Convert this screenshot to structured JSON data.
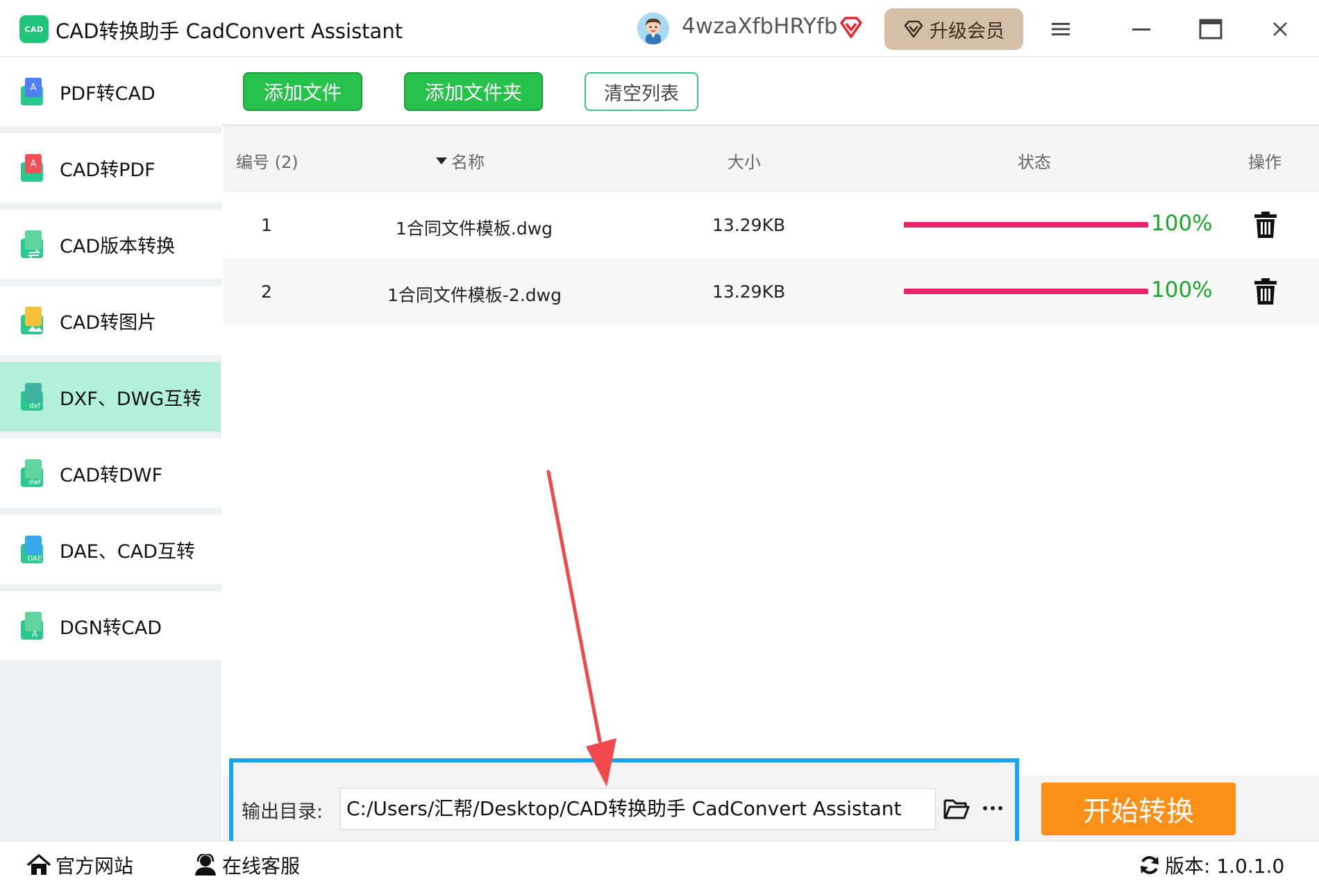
{
  "window": {
    "logo_text": "CAD",
    "title": "CAD转换助手 CadConvert Assistant",
    "username": "4wzaXfbHRYfb",
    "upgrade_label": "升级会员",
    "icons": [
      "avatar",
      "vip-icon",
      "menu-icon",
      "minimize-icon",
      "maximize-icon",
      "close-icon"
    ]
  },
  "sidebar": {
    "items": [
      {
        "label": "PDF转CAD",
        "icon": "pdf-to-cad-icon",
        "active": false
      },
      {
        "label": "CAD转PDF",
        "icon": "cad-to-pdf-icon",
        "active": false
      },
      {
        "label": "CAD版本转换",
        "icon": "cad-version-icon",
        "active": false
      },
      {
        "label": "CAD转图片",
        "icon": "cad-to-image-icon",
        "active": false
      },
      {
        "label": "DXF、DWG互转",
        "icon": "dxf-dwg-icon",
        "active": true
      },
      {
        "label": "CAD转DWF",
        "icon": "cad-to-dwf-icon",
        "active": false
      },
      {
        "label": "DAE、CAD互转",
        "icon": "dae-cad-icon",
        "active": false
      },
      {
        "label": "DGN转CAD",
        "icon": "dgn-to-cad-icon",
        "active": false
      }
    ]
  },
  "toolbar": {
    "add_file": "添加文件",
    "add_folder": "添加文件夹",
    "clear_list": "清空列表"
  },
  "table": {
    "headers": {
      "index": "编号 (2)",
      "name": "名称",
      "size": "大小",
      "status": "状态",
      "action": "操作"
    },
    "rows": [
      {
        "index": "1",
        "name": "1合同文件模板.dwg",
        "size": "13.29KB",
        "progress": 1.0,
        "percent": "100%"
      },
      {
        "index": "2",
        "name": "1合同文件模板-2.dwg",
        "size": "13.29KB",
        "progress": 1.0,
        "percent": "100%"
      }
    ]
  },
  "output": {
    "label": "输出目录:",
    "path": "C:/Users/汇帮/Desktop/CAD转换助手 CadConvert Assistant"
  },
  "start_button": "开始转换",
  "footer": {
    "website": "官方网站",
    "support": "在线客服",
    "version": "版本: 1.0.1.0"
  },
  "colors": {
    "brand_green": "#27c24c",
    "active_item": "#b3f0dc",
    "progress": "#e8236b",
    "percent_text": "#1aa62a",
    "start_orange": "#fb8f17",
    "highlight_blue": "#1aa3ee",
    "arrow_red": "#f0484c"
  }
}
